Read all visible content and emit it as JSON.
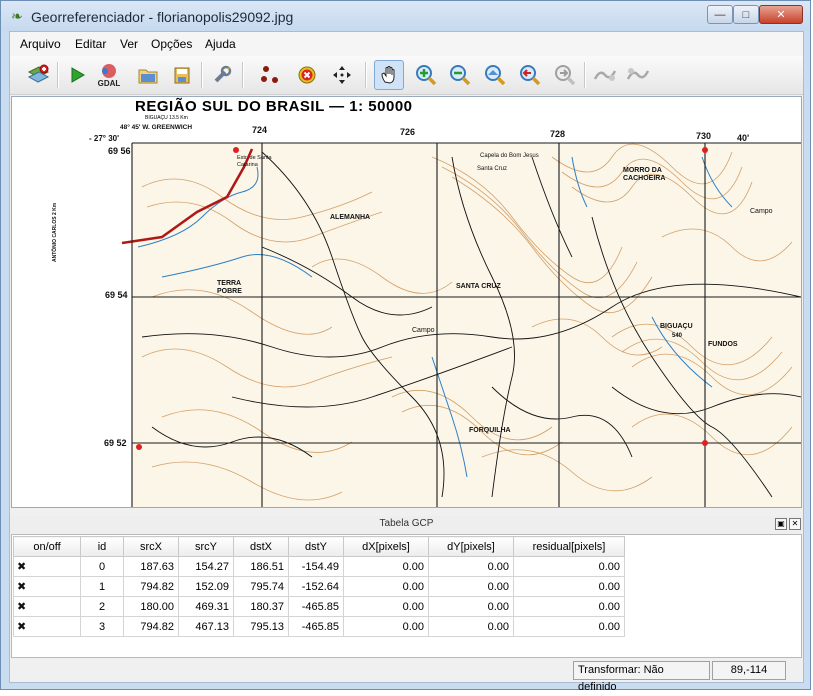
{
  "window": {
    "title": "Georreferenciador - florianopolis29092.jpg",
    "minimize_label": "—",
    "maximize_label": "□",
    "close_label": "✕"
  },
  "menu": [
    "Arquivo",
    "Editar",
    "Ver",
    "Opções",
    "Ajuda"
  ],
  "toolbar": {
    "gdal_label": "GDAL",
    "icons": [
      "open-raster-icon",
      "start-georeferencing-icon",
      "generate-gdal-script-icon",
      "load-gcp-points-icon",
      "save-gcp-points-icon",
      "transformation-settings-icon",
      "add-point-icon",
      "delete-point-icon",
      "move-gcp-point-icon",
      "pan-icon",
      "zoom-in-icon",
      "zoom-out-icon",
      "zoom-to-layer-icon",
      "zoom-last-icon",
      "zoom-next-icon",
      "link-georeferencer-to-qgis-icon",
      "link-qgis-to-georeferencer-icon"
    ],
    "active": "pan-icon"
  },
  "map": {
    "title": "REGIÃO SUL DO BRASIL — 1: 50000",
    "subtitle": "BIGUAÇU 13.5 Km",
    "coord_longitude": "48° 45'  W. GREENWICH",
    "coord_latitude": "- 27° 30'",
    "x_ticks": [
      "724",
      "726",
      "728",
      "730",
      "40'"
    ],
    "y_ticks": [
      "69 56",
      "69 54",
      "69 52"
    ],
    "place_names": [
      "ALEMANHA",
      "SANTA CRUZ",
      "TERRA POBRE",
      "Campo",
      "BIGUAÇU",
      "FUNDOS",
      "FORQUILHA",
      "MORRO DA CACHOEIRA",
      "Santa Cruz",
      "Capela do Bom Jesus",
      "Campo",
      "ANTÔNIO CARLOS 2 Km",
      "540",
      "Estr. de Santa Catarina"
    ]
  },
  "gcp_panel": {
    "title": "Tabela GCP",
    "float_label": "▣",
    "close_label": "✕",
    "columns": [
      "on/off",
      "id",
      "srcX",
      "srcY",
      "dstX",
      "dstY",
      "dX[pixels]",
      "dY[pixels]",
      "residual[pixels]"
    ],
    "rows": [
      {
        "enabled": true,
        "id": "0",
        "srcX": "187.63",
        "srcY": "154.27",
        "dstX": "186.51",
        "dstY": "-154.49",
        "dX": "0.00",
        "dY": "0.00",
        "residual": "0.00"
      },
      {
        "enabled": true,
        "id": "1",
        "srcX": "794.82",
        "srcY": "152.09",
        "dstX": "795.74",
        "dstY": "-152.64",
        "dX": "0.00",
        "dY": "0.00",
        "residual": "0.00"
      },
      {
        "enabled": true,
        "id": "2",
        "srcX": "180.00",
        "srcY": "469.31",
        "dstX": "180.37",
        "dstY": "-465.85",
        "dX": "0.00",
        "dY": "0.00",
        "residual": "0.00"
      },
      {
        "enabled": true,
        "id": "3",
        "srcX": "794.82",
        "srcY": "467.13",
        "dstX": "795.13",
        "dstY": "-465.85",
        "dX": "0.00",
        "dY": "0.00",
        "residual": "0.00"
      }
    ],
    "checkbox_glyph": "✖"
  },
  "status": {
    "transform": "Transformar: Não definido",
    "coords": "89,-114"
  },
  "colors": {
    "contour": "#c8823c",
    "river": "#2f7fc4",
    "road": "#b01818",
    "grid": "#1a1a1a",
    "gcp_point": "#e02020"
  }
}
